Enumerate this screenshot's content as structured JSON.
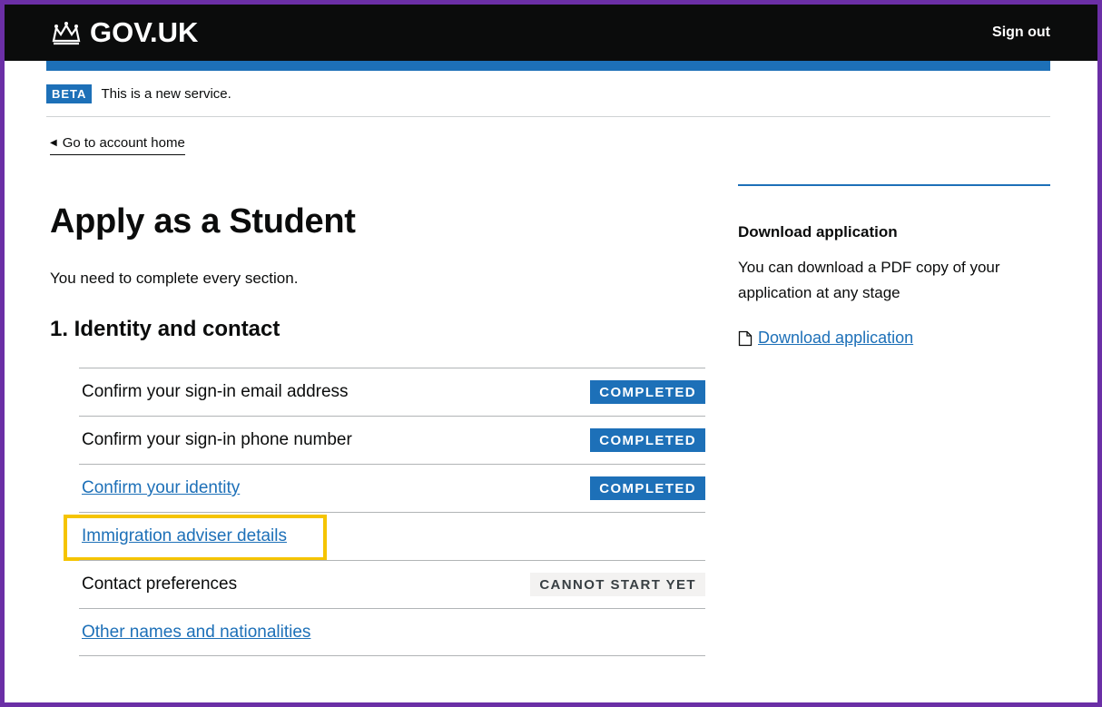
{
  "header": {
    "logo_text": "GOV.UK",
    "sign_out": "Sign out"
  },
  "phase_banner": {
    "tag": "BETA",
    "text": "This is a new service."
  },
  "back_link": "Go to account home",
  "main": {
    "title": "Apply as a Student",
    "lead": "You need to complete every section.",
    "section_title": "1. Identity and contact",
    "tasks": [
      {
        "label": "Confirm your sign-in email address",
        "status": "COMPLETED"
      },
      {
        "label": "Confirm your sign-in phone number",
        "status": "COMPLETED"
      },
      {
        "label": "Confirm your identity",
        "status": "COMPLETED"
      },
      {
        "label": "Immigration adviser details",
        "status": ""
      },
      {
        "label": "Contact preferences",
        "status": "CANNOT START YET"
      },
      {
        "label": "Other names and nationalities",
        "status": ""
      }
    ]
  },
  "sidebar": {
    "title": "Download application",
    "text": "You can download a PDF copy of your application at any stage",
    "link": "Download application"
  },
  "colors": {
    "brand_blue": "#1d70b8",
    "header_black": "#0b0c0c",
    "highlight_yellow": "#f5c400",
    "frame_purple": "#6b2fa6"
  },
  "icons": {
    "logo": "crown-icon",
    "back": "triangle-left-icon",
    "download": "document-icon"
  }
}
